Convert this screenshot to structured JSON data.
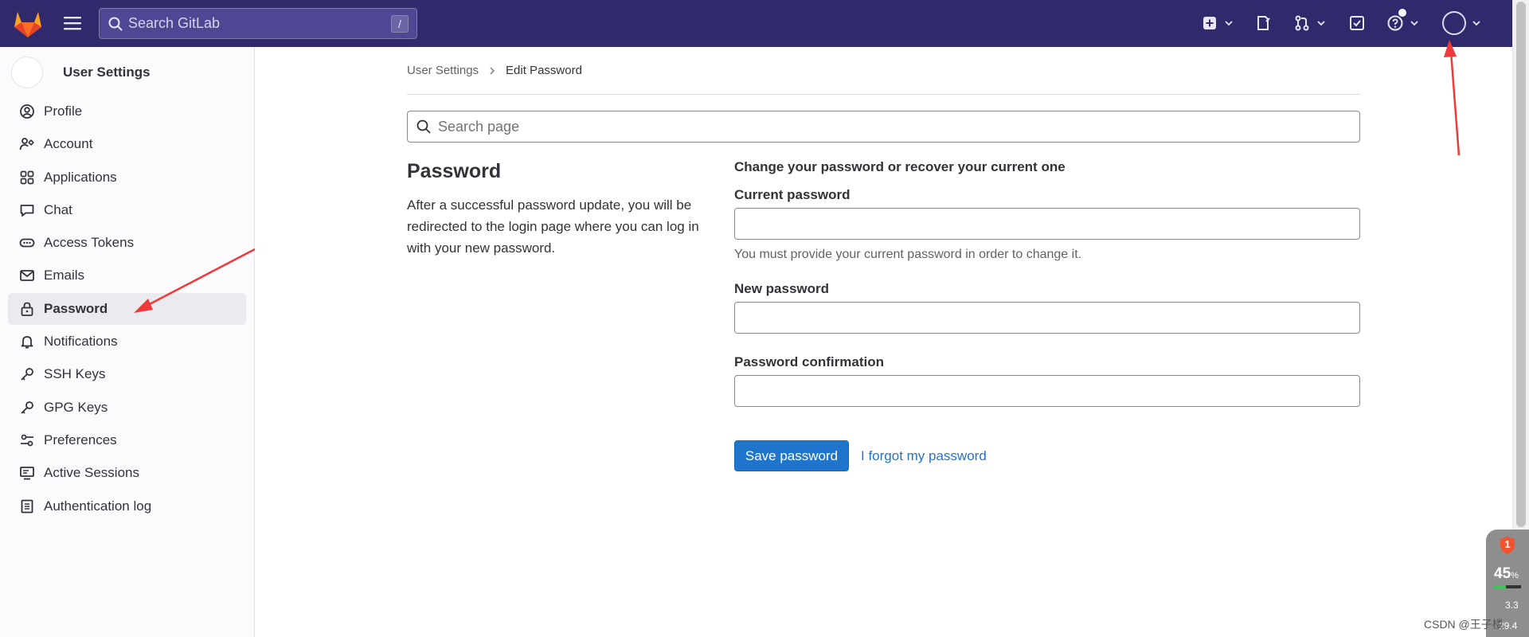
{
  "colors": {
    "topbar": "#2f2a6b",
    "primary_button": "#1f75cb",
    "link": "#1f75cb",
    "annotation_arrow": "#f03a3a"
  },
  "topbar": {
    "search_placeholder": "Search GitLab",
    "search_shortcut": "/",
    "icons": [
      "gitlab-logo",
      "hamburger-menu",
      "create-new",
      "issues",
      "merge-requests",
      "todos",
      "help",
      "user-avatar"
    ]
  },
  "sidebar": {
    "title": "User Settings",
    "items": [
      {
        "label": "Profile",
        "icon": "user-circle",
        "active": false
      },
      {
        "label": "Account",
        "icon": "account-settings",
        "active": false
      },
      {
        "label": "Applications",
        "icon": "applications",
        "active": false
      },
      {
        "label": "Chat",
        "icon": "chat",
        "active": false
      },
      {
        "label": "Access Tokens",
        "icon": "token",
        "active": false
      },
      {
        "label": "Emails",
        "icon": "mail",
        "active": false
      },
      {
        "label": "Password",
        "icon": "lock",
        "active": true
      },
      {
        "label": "Notifications",
        "icon": "bell",
        "active": false
      },
      {
        "label": "SSH Keys",
        "icon": "key",
        "active": false
      },
      {
        "label": "GPG Keys",
        "icon": "key",
        "active": false
      },
      {
        "label": "Preferences",
        "icon": "preferences",
        "active": false
      },
      {
        "label": "Active Sessions",
        "icon": "monitor",
        "active": false
      },
      {
        "label": "Authentication log",
        "icon": "log",
        "active": false
      }
    ]
  },
  "breadcrumb": {
    "parent": "User Settings",
    "current": "Edit Password"
  },
  "page_search": {
    "placeholder": "Search page"
  },
  "section": {
    "title": "Password",
    "description": "After a successful password update, you will be redirected to the login page where you can log in with your new password."
  },
  "form": {
    "intro": "Change your password or recover your current one",
    "current_password_label": "Current password",
    "current_password_help": "You must provide your current password in order to change it.",
    "new_password_label": "New password",
    "confirmation_label": "Password confirmation",
    "save_button": "Save password",
    "forgot_link": "I forgot my password"
  },
  "perf_widget": {
    "badge": "1",
    "percent": "45",
    "percent_unit": "%",
    "line1": "3.3",
    "line2": "29.4"
  },
  "watermark": "CSDN @王子楼"
}
